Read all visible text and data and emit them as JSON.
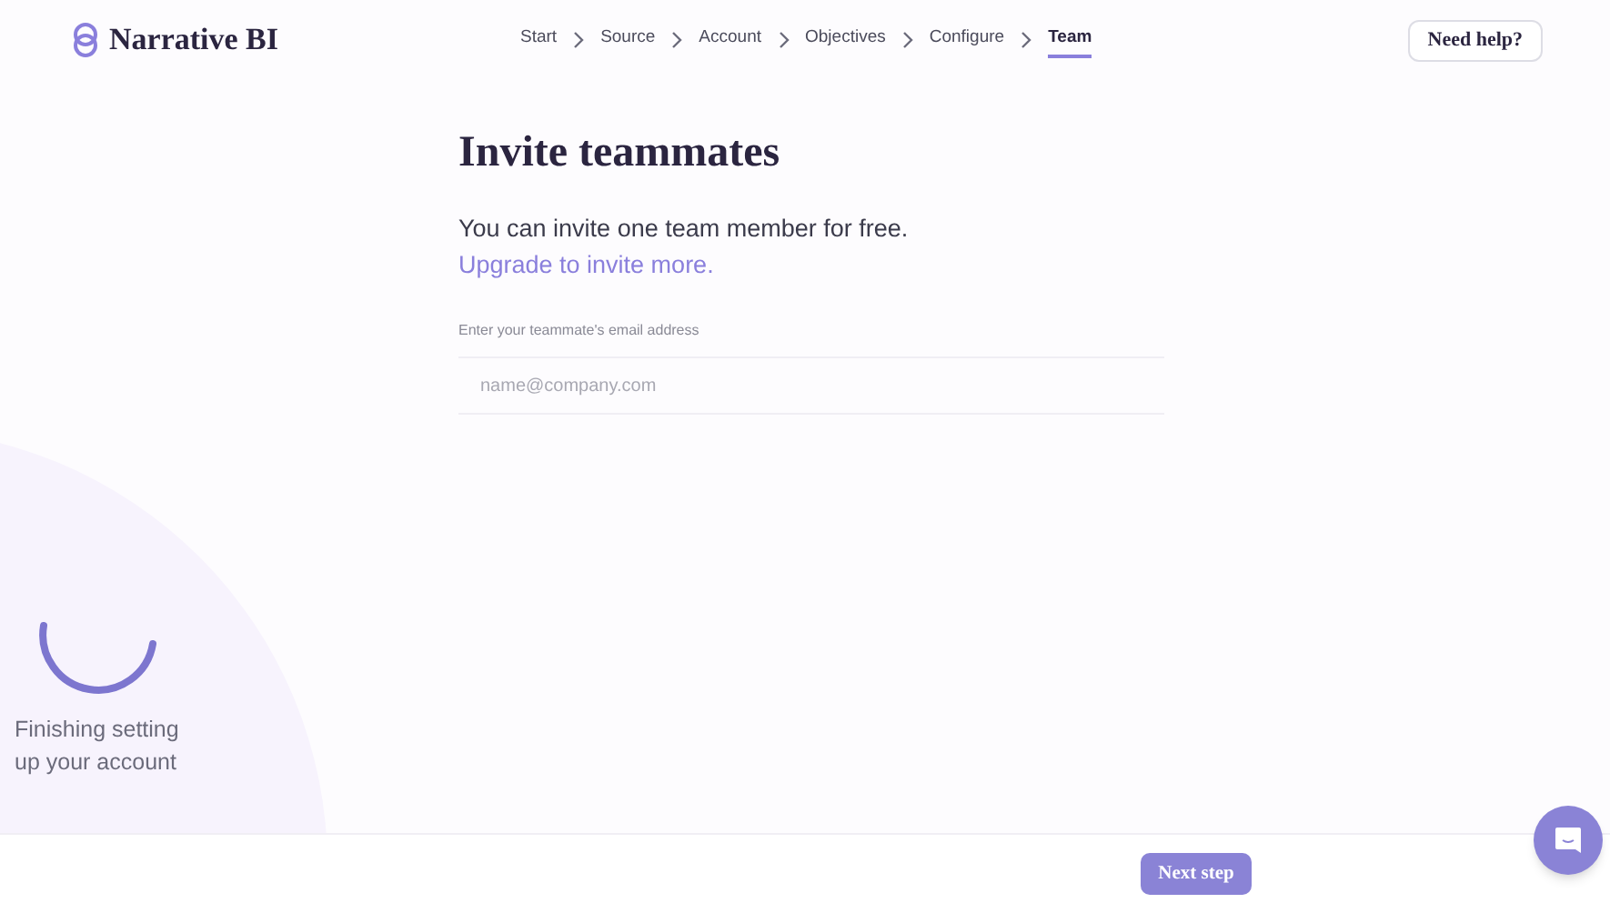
{
  "brand": {
    "name": "Narrative BI"
  },
  "steps": [
    {
      "label": "Start",
      "selected": false
    },
    {
      "label": "Source",
      "selected": false
    },
    {
      "label": "Account",
      "selected": false
    },
    {
      "label": "Objectives",
      "selected": false
    },
    {
      "label": "Configure",
      "selected": false
    },
    {
      "label": "Team",
      "selected": true
    }
  ],
  "help_button": "Need help?",
  "title": "Invite teammates",
  "intro": "You can invite one team member for free.",
  "upgrade_link": "Upgrade to invite more.",
  "email_field": {
    "label": "Enter your teammate's email address",
    "placeholder": "name@company.com"
  },
  "progress": {
    "message": "Finishing setting up your account"
  },
  "next_button": "Next step"
}
